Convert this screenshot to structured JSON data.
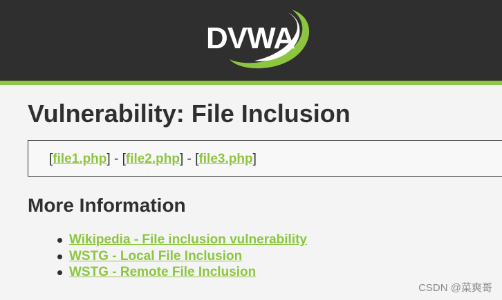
{
  "header": {
    "logo_text": "DVWA"
  },
  "page": {
    "title": "Vulnerability: File Inclusion"
  },
  "file_box": {
    "link1": "file1.php",
    "link2": "file2.php",
    "link3": "file3.php",
    "open_bracket": "[",
    "close_bracket": "]",
    "separator": " - "
  },
  "more_info": {
    "heading": "More Information",
    "links": [
      "Wikipedia - File inclusion vulnerability",
      "WSTG - Local File Inclusion",
      "WSTG - Remote File Inclusion"
    ]
  },
  "watermark": {
    "text": "CSDN @菜爽哥"
  },
  "colors": {
    "header_bg": "#2f2f2f",
    "accent_green": "#8cc63f",
    "page_bg": "#f4f4f4"
  }
}
